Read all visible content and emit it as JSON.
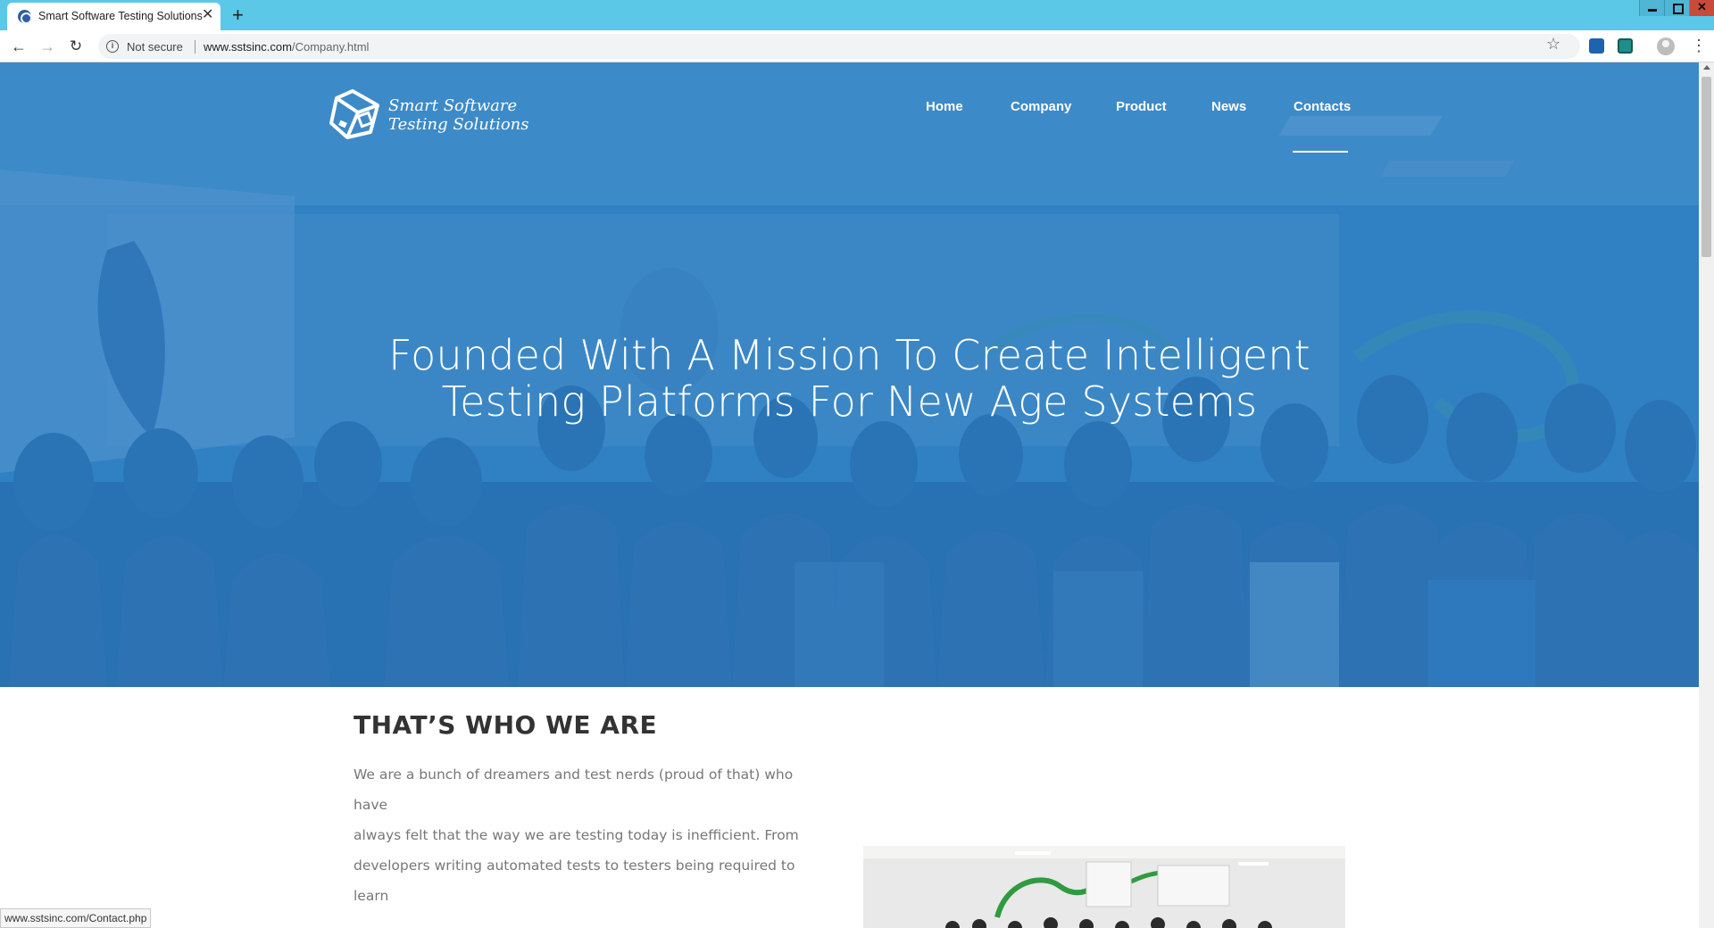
{
  "browser": {
    "tab_title": "Smart Software Testing Solutions",
    "tab_close": "✕",
    "new_tab": "+",
    "security_label": "Not secure",
    "url_host": "www.sstsinc.com",
    "url_path": "/Company.html",
    "status_url": "www.sstsinc.com/Contact.php"
  },
  "site": {
    "logo_line1": "Smart Software",
    "logo_line2": "Testing Solutions",
    "nav": [
      {
        "label": "Home"
      },
      {
        "label": "Company"
      },
      {
        "label": "Product"
      },
      {
        "label": "News"
      },
      {
        "label": "Contacts"
      }
    ],
    "active_nav": "Contacts"
  },
  "hero": {
    "title_line1": "Founded With A Mission To Create Intelligent",
    "title_line2": "Testing Platforms For New Age Systems"
  },
  "about": {
    "heading": "THAT’S WHO WE ARE",
    "line1": "We are a bunch of dreamers and test nerds (proud of that) who have",
    "line2": "always felt that the way we are testing today is inefficient. From",
    "line3": "developers writing automated tests to testers being required to learn"
  },
  "colors": {
    "tabstrip": "#5bc8e8",
    "hero_overlay": "#2676be",
    "white": "#ffffff"
  }
}
